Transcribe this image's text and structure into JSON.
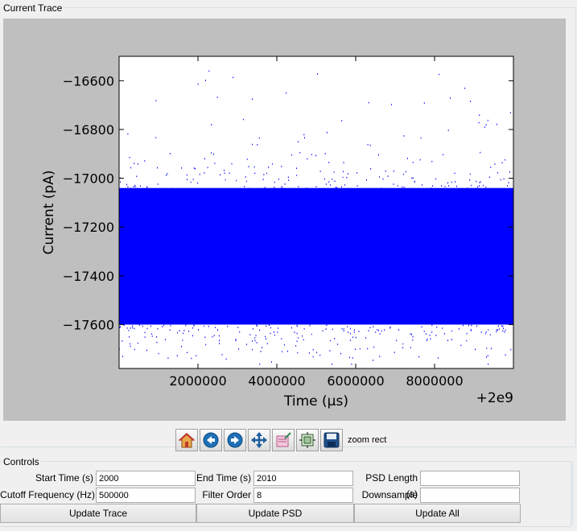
{
  "trace_group": {
    "title": "Current Trace"
  },
  "chart_data": {
    "type": "scatter",
    "xlabel": "Time (μs)",
    "ylabel": "Current (pA)",
    "x_offset_label": "+2e9",
    "xlim": [
      0,
      10000000
    ],
    "ylim": [
      -17780,
      -16500
    ],
    "xticks": [
      2000000,
      4000000,
      6000000,
      8000000
    ],
    "xtick_labels": [
      "2000000",
      "4000000",
      "6000000",
      "8000000"
    ],
    "yticks": [
      -17600,
      -17400,
      -17200,
      -17000,
      -16800,
      -16600
    ],
    "ytick_labels": [
      "−17600",
      "−17400",
      "−17200",
      "−17000",
      "−16800",
      "−16600"
    ],
    "grid": false,
    "color": "#0000ff",
    "series": [
      {
        "dense_band": [
          -17600,
          -17040
        ],
        "outlier_range": [
          -17760,
          -16540
        ]
      }
    ]
  },
  "toolbar": {
    "buttons": [
      "home-icon",
      "back-icon",
      "forward-icon",
      "pan-icon",
      "zoom-icon",
      "subplots-icon",
      "save-icon"
    ],
    "status": "zoom rect"
  },
  "controls": {
    "title": "Controls",
    "start_time_label": "Start Time (s)",
    "start_time_value": "2000",
    "end_time_label": "End Time (s)",
    "end_time_value": "2010",
    "psd_length_label": "PSD Length (s)",
    "psd_length_value": "",
    "cutoff_label": "Cutoff Frequency (Hz)",
    "cutoff_value": "500000",
    "filter_order_label": "Filter Order",
    "filter_order_value": "8",
    "downsample_label": "Downsample",
    "downsample_value": "",
    "update_trace": "Update Trace",
    "update_psd": "Update PSD",
    "update_all": "Update All"
  }
}
